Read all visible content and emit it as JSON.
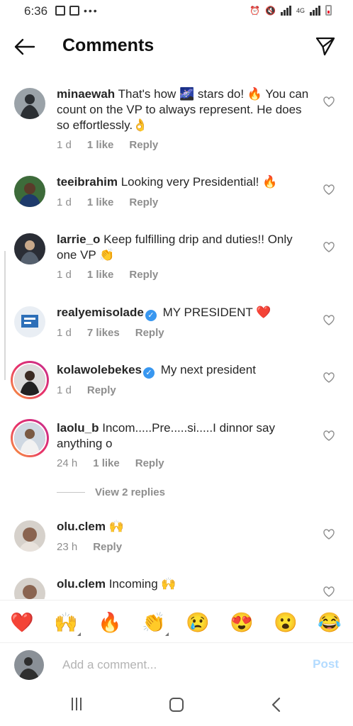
{
  "status": {
    "time": "6:36",
    "network": "4G"
  },
  "header": {
    "title": "Comments"
  },
  "comments": [
    {
      "username": "minaewah",
      "text": "That's how 🌌 stars do! 🔥 You can count on the VP to always represent. He does so effortlessly.👌",
      "time": "1 d",
      "likes": "1 like",
      "reply": "Reply",
      "verified": false
    },
    {
      "username": "teeibrahim",
      "text": "Looking very Presidential! 🔥",
      "time": "1 d",
      "likes": "1 like",
      "reply": "Reply",
      "verified": false
    },
    {
      "username": "larrie_o",
      "text": "Keep fulfilling drip and duties!! Only one VP 👏",
      "time": "1 d",
      "likes": "1 like",
      "reply": "Reply",
      "verified": false
    },
    {
      "username": "realyemisolade",
      "text": "MY PRESIDENT ❤️",
      "time": "1 d",
      "likes": "7 likes",
      "reply": "Reply",
      "verified": true
    },
    {
      "username": "kolawolebekes",
      "text": "My next president",
      "time": "1 d",
      "likes": "",
      "reply": "Reply",
      "verified": true
    },
    {
      "username": "laolu_b",
      "text": "Incom.....Pre.....si.....I dinnor say anything o",
      "time": "24 h",
      "likes": "1 like",
      "reply": "Reply",
      "verified": false
    },
    {
      "username": "olu.clem",
      "text": "🙌",
      "time": "23 h",
      "likes": "",
      "reply": "Reply",
      "verified": false
    },
    {
      "username": "olu.clem",
      "text": "Incoming 🙌",
      "time": "",
      "likes": "",
      "reply": "",
      "verified": false
    }
  ],
  "view_replies": "View 2 replies",
  "emoji_bar": [
    "❤️",
    "🙌",
    "🔥",
    "👏",
    "😢",
    "😍",
    "😮",
    "😂"
  ],
  "add_comment": {
    "placeholder": "Add a comment...",
    "post_label": "Post"
  },
  "colors": {
    "link_blue": "#3897f0",
    "post_disabled": "#b3dbff",
    "muted": "#8e8e8e"
  }
}
